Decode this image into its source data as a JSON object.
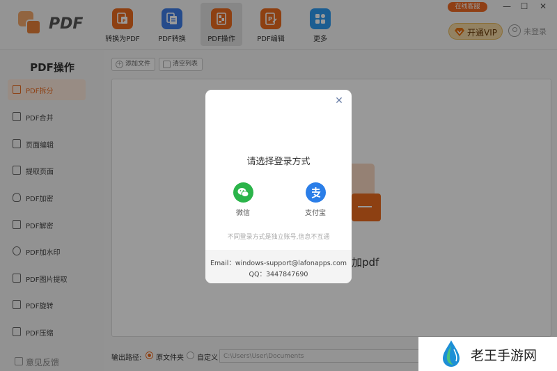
{
  "app": {
    "logo_text": "PDF"
  },
  "toolbar": {
    "items": [
      {
        "label": "转换为PDF",
        "color": "#ec6b1f",
        "icon": "convert-to-pdf-icon"
      },
      {
        "label": "PDF转换",
        "color": "#3f7de8",
        "icon": "pdf-convert-icon"
      },
      {
        "label": "PDF操作",
        "color": "#ec6b1f",
        "icon": "pdf-operate-icon",
        "active": true
      },
      {
        "label": "PDF编辑",
        "color": "#ec6b1f",
        "icon": "pdf-edit-icon"
      },
      {
        "label": "更多",
        "color": "#2e9cf2",
        "icon": "more-grid-icon"
      }
    ]
  },
  "header": {
    "service_label": "在线客服",
    "vip_label": "开通VIP",
    "login_label": "未登录",
    "window_controls": [
      "—",
      "☐",
      "✕"
    ]
  },
  "sidebar": {
    "title": "PDF操作",
    "items": [
      {
        "label": "PDF拆分",
        "active": true
      },
      {
        "label": "PDF合并"
      },
      {
        "label": "页面编辑"
      },
      {
        "label": "提取页面"
      },
      {
        "label": "PDF加密"
      },
      {
        "label": "PDF解密"
      },
      {
        "label": "PDF加水印"
      },
      {
        "label": "PDF图片提取"
      },
      {
        "label": "PDF旋转"
      },
      {
        "label": "PDF压缩"
      }
    ],
    "feedback_label": "意见反馈"
  },
  "main": {
    "add_file_label": "添加文件",
    "clear_list_label": "清空列表",
    "drop_text": "加pdf",
    "output_label": "输出路径:",
    "radio_original": "原文件夹",
    "radio_custom": "自定义",
    "path_value": "C:\\Users\\User\\Documents"
  },
  "modal": {
    "close_symbol": "✕",
    "title": "请选择登录方式",
    "wechat_label": "微信",
    "alipay_label": "支付宝",
    "note": "不同登录方式是独立账号,信息不互通",
    "email_line": "Email：windows-support@lafonapps.com",
    "qq_line": "QQ：3447847690"
  },
  "watermark": {
    "text": "老王手游网"
  }
}
